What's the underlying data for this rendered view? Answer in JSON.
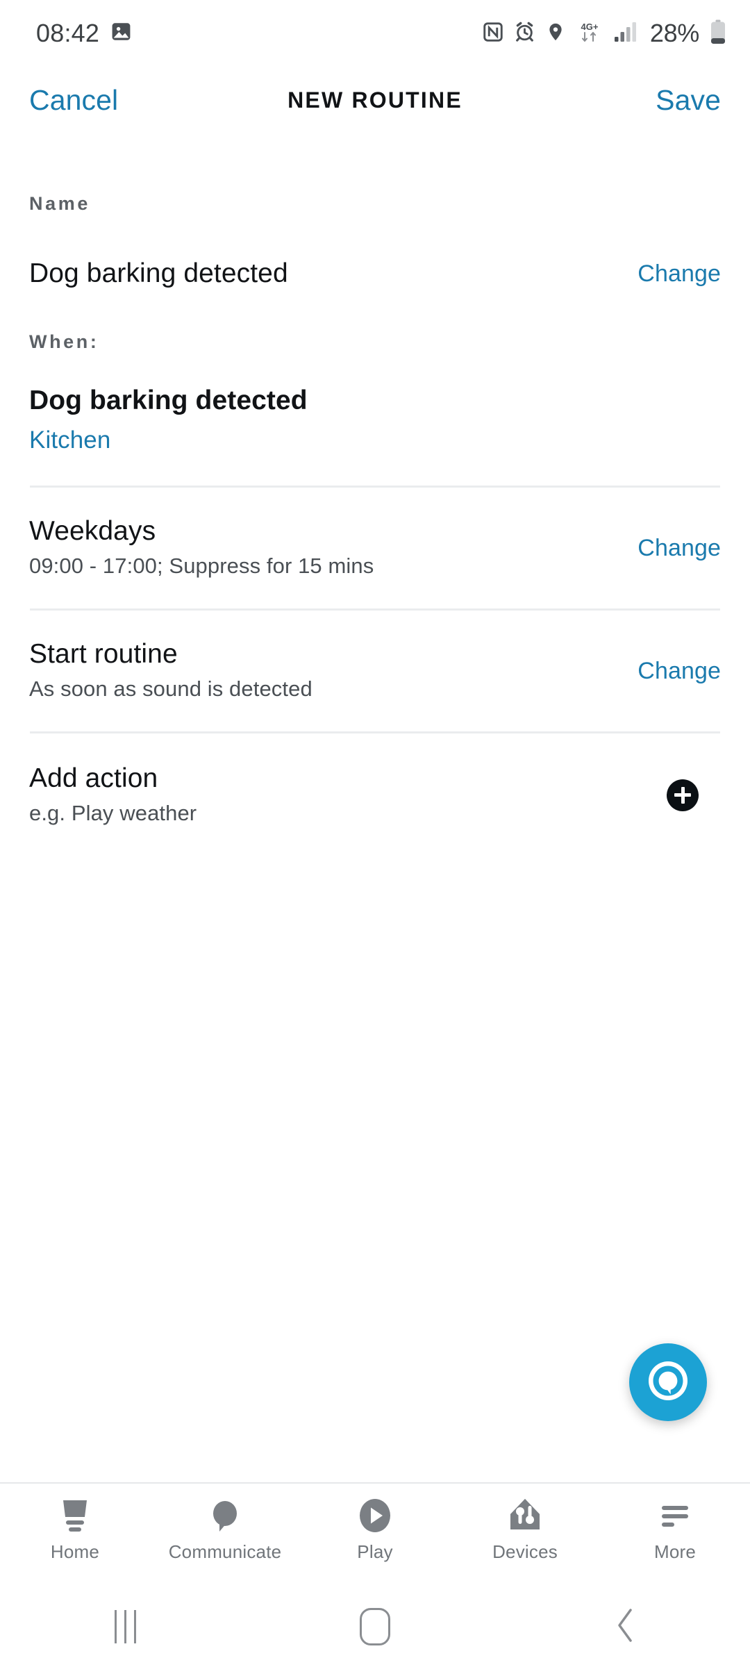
{
  "status_bar": {
    "time": "08:42",
    "battery_percent": "28%",
    "network_type": "4G+",
    "icons": [
      "photo-icon",
      "nfc-icon",
      "alarm-icon",
      "location-icon",
      "mobile-data-icon",
      "signal-icon",
      "battery-icon"
    ]
  },
  "header": {
    "cancel_label": "Cancel",
    "title": "NEW ROUTINE",
    "save_label": "Save",
    "accent_color": "#1a7aad"
  },
  "name_section": {
    "label": "Name",
    "value": "Dog barking detected",
    "change_label": "Change"
  },
  "when_section": {
    "label": "When:",
    "trigger_title": "Dog barking detected",
    "trigger_location": "Kitchen"
  },
  "rows": [
    {
      "title": "Weekdays",
      "subtitle": "09:00 - 17:00; Suppress for 15 mins",
      "action_label": "Change"
    },
    {
      "title": "Start routine",
      "subtitle": "As soon as sound is detected",
      "action_label": "Change"
    }
  ],
  "add_action": {
    "title": "Add action",
    "subtitle": "e.g. Play weather",
    "icon": "plus-icon"
  },
  "alexa_button": {
    "icon": "alexa-icon",
    "color": "#1ca2d4"
  },
  "bottom_nav": {
    "items": [
      {
        "label": "Home",
        "icon": "echo-device-icon"
      },
      {
        "label": "Communicate",
        "icon": "speech-bubble-icon"
      },
      {
        "label": "Play",
        "icon": "play-circle-icon"
      },
      {
        "label": "Devices",
        "icon": "smart-home-icon"
      },
      {
        "label": "More",
        "icon": "hamburger-menu-icon"
      }
    ]
  },
  "android_nav": {
    "recents": "recents-icon",
    "home": "home-icon",
    "back": "back-icon"
  }
}
